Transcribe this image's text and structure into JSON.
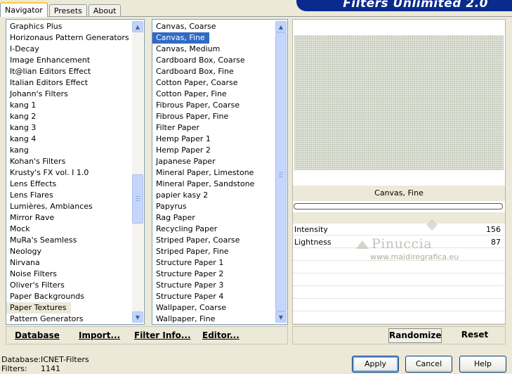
{
  "app": {
    "title": "Filters Unlimited 2.0"
  },
  "tabs": [
    {
      "label": "Navigator",
      "active": true
    },
    {
      "label": "Presets",
      "active": false
    },
    {
      "label": "About",
      "active": false
    }
  ],
  "categories": {
    "items": [
      "Graphics Plus",
      "Horizonaus Pattern Generators",
      "I-Decay",
      "Image Enhancement",
      "It@lian Editors Effect",
      "Italian Editors Effect",
      "Johann's Filters",
      "kang 1",
      "kang 2",
      "kang 3",
      "kang 4",
      "kang",
      "Kohan's Filters",
      "Krusty's FX vol. I 1.0",
      "Lens Effects",
      "Lens Flares",
      "Lumières, Ambiances",
      "Mirror Rave",
      "Mock",
      "MuRa's Seamless",
      "Neology",
      "Nirvana",
      "Noise Filters",
      "Oliver's Filters",
      "Paper Backgrounds",
      "Paper Textures",
      "Pattern Generators"
    ],
    "selected_index": 25
  },
  "filters": {
    "items": [
      "Canvas, Coarse",
      "Canvas, Fine",
      "Canvas, Medium",
      "Cardboard Box, Coarse",
      "Cardboard Box, Fine",
      "Cotton Paper, Coarse",
      "Cotton Paper, Fine",
      "Fibrous Paper, Coarse",
      "Fibrous Paper, Fine",
      "Filter Paper",
      "Hemp Paper 1",
      "Hemp Paper 2",
      "Japanese Paper",
      "Mineral Paper, Limestone",
      "Mineral Paper, Sandstone",
      "papier kasy 2",
      "Papyrus",
      "Rag Paper",
      "Recycling Paper",
      "Striped Paper, Coarse",
      "Striped Paper, Fine",
      "Structure Paper 1",
      "Structure Paper 2",
      "Structure Paper 3",
      "Structure Paper 4",
      "Wallpaper, Coarse",
      "Wallpaper, Fine"
    ],
    "selected_index": 1
  },
  "preview": {
    "filter_name": "Canvas, Fine",
    "progress": 0
  },
  "params": [
    {
      "name": "Intensity",
      "value": "156"
    },
    {
      "name": "Lightness",
      "value": "87"
    }
  ],
  "watermark": {
    "title": "Pinuccia",
    "url": "www.maidiregrafica.eu"
  },
  "left_actions": {
    "database": "Database",
    "import": "Import...",
    "filter_info": "Filter Info...",
    "editor": "Editor..."
  },
  "right_actions": {
    "randomize": "Randomize",
    "reset": "Reset"
  },
  "status": {
    "database_label": "Database:",
    "database_value": "ICNET-Filters",
    "filters_label": "Filters:",
    "filters_value": "1141"
  },
  "dialog_buttons": {
    "apply": "Apply",
    "cancel": "Cancel",
    "help": "Help"
  },
  "colors": {
    "selection": "#316AC5",
    "banner": "#0A2A8C",
    "face": "#ECE9D8"
  }
}
